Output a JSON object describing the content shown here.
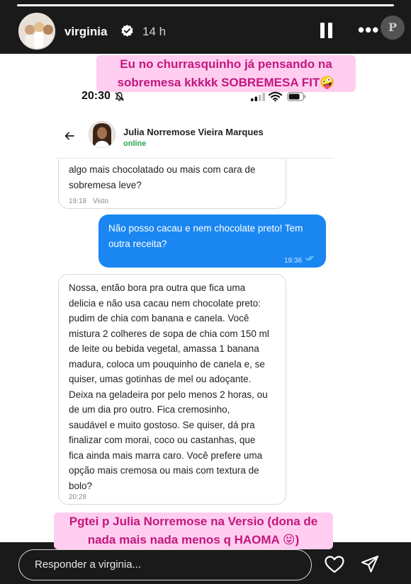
{
  "story": {
    "progress": 1.0,
    "user": {
      "name": "virginia",
      "time_ago": "14 h",
      "verified": true
    },
    "watermark": "P",
    "caption_top": "Eu no churrasquinho já pensando na sobremesa kkkkk SOBREMESA FIT🤪",
    "caption_bottom": "Pgtei p Julia Norremose na Versio (dona de nada mais nada menos q HAOMA 😝)",
    "reply_placeholder": "Responder a virginia..."
  },
  "screenshot": {
    "status_time": "20:30",
    "contact": {
      "name": "Julia Norremose Vieira Marques",
      "status": "online"
    },
    "messages": [
      {
        "direction": "in",
        "lines": [
          "algo mais chocolatado ou mais com cara de",
          "sobremesa leve?"
        ],
        "time": "19:18",
        "status": "Visto"
      },
      {
        "direction": "out",
        "lines": [
          "Não posso cacau e nem chocolate preto! Tem",
          "outra receita?"
        ],
        "time": "19:36"
      },
      {
        "direction": "in",
        "lines": [
          "Nossa, então bora pra outra que fica uma",
          "delicia e não usa cacau nem chocolate preto:",
          "pudim de chia com banana e canela. Você",
          "mistura 2 colheres de sopa de chia com 150 ml",
          "de leite ou bebida vegetal, amassa 1 banana",
          "madura, coloca um pouquinho de canela e, se",
          "quiser, umas gotinhas de mel ou adoçante.",
          "Deixa na geladeira por pelo menos 2 horas, ou",
          "de um dia pro outro. Fica cremosinho,",
          "saudável e muito gostoso. Se quiser, dá pra",
          "finalizar com morai, coco ou castanhas, que",
          "fica ainda mais marra caro. Você prefere uma",
          "opção mais cremosa ou mais com textura de",
          "bolo?"
        ],
        "time": "20:28"
      }
    ]
  },
  "colors": {
    "caption_bg": "#ffcdf0",
    "caption_text": "#c2177e",
    "outgoing_bubble": "#1a86f2",
    "online_green": "#2aa84f"
  },
  "icons": [
    "verified-badge-icon",
    "pause-icon",
    "more-icon",
    "mute-icon",
    "signal-icon",
    "wifi-icon",
    "battery-icon",
    "back-arrow-icon",
    "read-ticks-icon",
    "heart-icon",
    "send-icon"
  ]
}
